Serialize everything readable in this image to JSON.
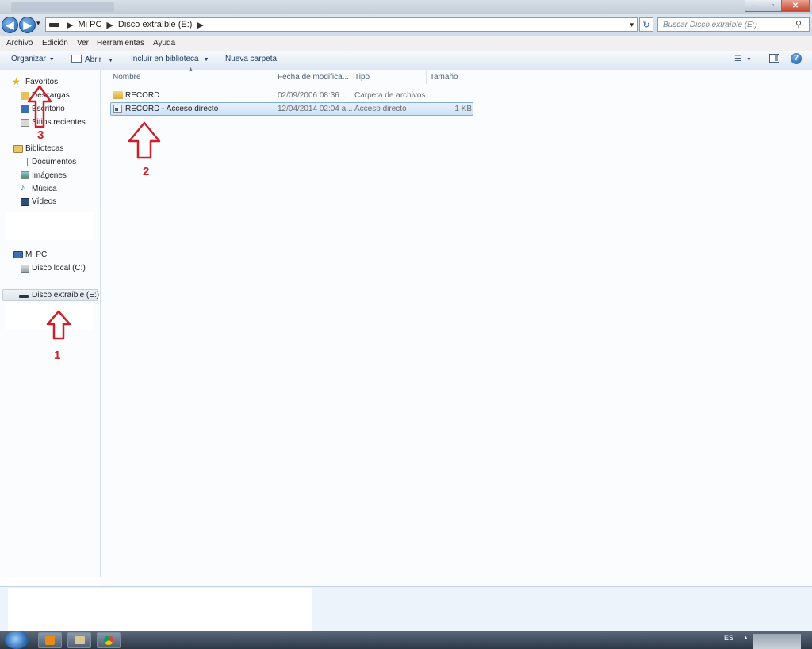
{
  "window": {
    "minimize": "‒",
    "maximize": "▫",
    "close": "✕"
  },
  "nav_buttons": {
    "back": "◀",
    "forward": "▶",
    "recent": "▾"
  },
  "address": {
    "crumbs": [
      "Mi PC",
      "Disco extraíble (E:)"
    ],
    "dropdown": "▾",
    "refresh": "↻"
  },
  "search": {
    "placeholder": "Buscar Disco extraíble (E:)"
  },
  "menu": [
    "Archivo",
    "Edición",
    "Ver",
    "Herramientas",
    "Ayuda"
  ],
  "toolbar": {
    "organize": "Organizar",
    "open": "Abrir",
    "include": "Incluir en biblioteca",
    "new_folder": "Nueva carpeta"
  },
  "nav": {
    "favorites": "Favoritos",
    "favorites_items": [
      "Descargas",
      "Escritorio",
      "Sitios recientes"
    ],
    "libraries": "Bibliotecas",
    "libraries_items": [
      "Documentos",
      "Imágenes",
      "Música",
      "Vídeos"
    ],
    "computer": "Mi PC",
    "computer_items": [
      "Disco local (C:)"
    ],
    "removable": "Disco extraíble (E:)"
  },
  "columns": [
    "Nombre",
    "Fecha de modifica...",
    "Tipo",
    "Tamaño"
  ],
  "files": [
    {
      "name": "RECORD",
      "date": "02/09/2006 08:36 ...",
      "type": "Carpeta de archivos",
      "size": ""
    },
    {
      "name": "RECORD - Acceso directo",
      "date": "12/04/2014 02:04 a...",
      "type": "Acceso directo",
      "size": "1 KB"
    }
  ],
  "annotations": [
    "1",
    "2",
    "3"
  ],
  "taskbar": {
    "lang": "ES",
    "tray": "▲"
  },
  "colors": {
    "arrow": "#cc1f2a",
    "accent": "#1f5fa6"
  }
}
